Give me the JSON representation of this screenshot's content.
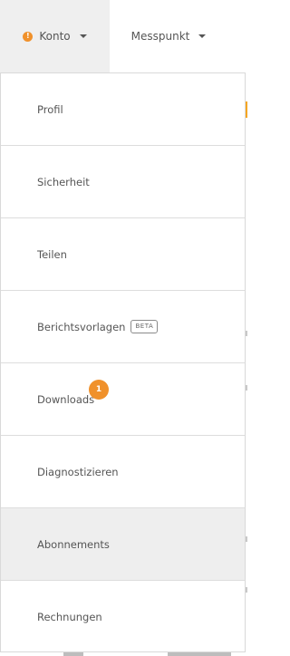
{
  "nav": {
    "account_tab": {
      "label": "Konto",
      "alert_icon": "exclamation-circle-icon",
      "alert_glyph": "!"
    },
    "measure_tab": {
      "label": "Messpunkt"
    }
  },
  "menu": {
    "items": [
      {
        "label": "Profil"
      },
      {
        "label": "Sicherheit"
      },
      {
        "label": "Teilen"
      },
      {
        "label": "Berichtsvorlagen",
        "badge": "BETA"
      },
      {
        "label": "Downloads",
        "count": "1"
      },
      {
        "label": "Diagnostizieren"
      },
      {
        "label": "Abonnements",
        "selected": true
      },
      {
        "label": "Rechnungen"
      }
    ]
  },
  "colors": {
    "accent": "#f0912b",
    "active_tab_bg": "#efefef",
    "selected_item_bg": "#eeeeee",
    "text": "#555555",
    "divider": "#dddddd"
  }
}
